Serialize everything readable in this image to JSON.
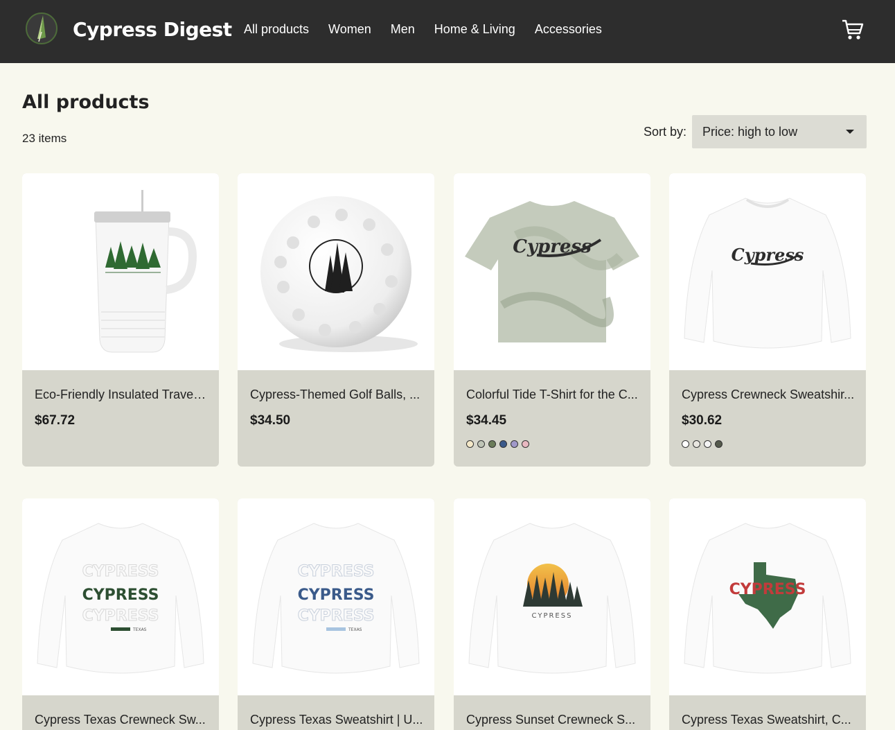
{
  "header": {
    "brand": "Cypress Digest",
    "nav": [
      "All products",
      "Women",
      "Men",
      "Home & Living",
      "Accessories"
    ],
    "cart_icon": "cart-icon",
    "logo_icon": "cypress-leaf-logo"
  },
  "main": {
    "title": "All products",
    "count": "23 items",
    "sort": {
      "label": "Sort by:",
      "value": "Price: high to low"
    }
  },
  "colors": {
    "header_bg": "#2d2d2d",
    "page_bg": "#f8f8ee",
    "card_footer": "#d6d6cc"
  },
  "products": [
    {
      "name": "Eco-Friendly Insulated Travel ...",
      "price": "$67.72",
      "image": "tumbler-with-pine-trees",
      "swatches": []
    },
    {
      "name": "Cypress-Themed Golf Balls, ...",
      "price": "$34.50",
      "image": "golf-ball-with-trees",
      "swatches": []
    },
    {
      "name": "Colorful Tide T-Shirt for the C...",
      "price": "$34.45",
      "image": "tie-dye-cypress-tshirt",
      "swatches": [
        "#f4e8c8",
        "#bfc4b6",
        "#6b7c5a",
        "#3b5a8a",
        "#a098c8",
        "#e8b8c0"
      ]
    },
    {
      "name": "Cypress Crewneck Sweatshir...",
      "price": "$30.62",
      "image": "cypress-crewneck-white",
      "swatches": [
        "#ffffff",
        "#e8e6e0",
        "#f4f4f4",
        "#555a4c"
      ]
    },
    {
      "name": "Cypress Texas Crewneck Sw...",
      "price": "",
      "image": "cypress-texas-green-sweatshirt",
      "swatches": []
    },
    {
      "name": "Cypress Texas Sweatshirt | U...",
      "price": "",
      "image": "cypress-texas-blue-sweatshirt",
      "swatches": []
    },
    {
      "name": "Cypress Sunset Crewneck S...",
      "price": "",
      "image": "cypress-sunset-sweatshirt",
      "swatches": []
    },
    {
      "name": "Cypress Texas Sweatshirt, C...",
      "price": "",
      "image": "cypress-texas-map-sweatshirt",
      "swatches": []
    }
  ],
  "print_text": {
    "cypress": "Cypress",
    "cypress_upper": "CYPRESS",
    "texas": "TEXAS"
  }
}
